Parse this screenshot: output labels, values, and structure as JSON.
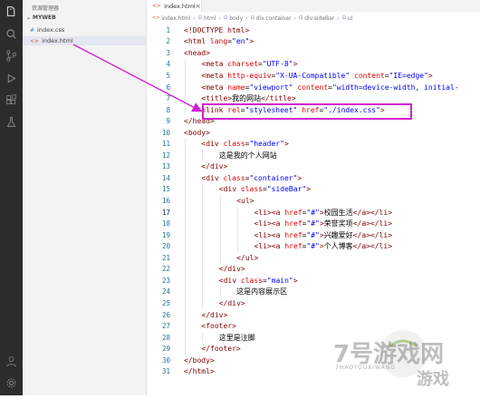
{
  "sidebar": {
    "title": "资源管理器",
    "folder": "MYWEB",
    "files": [
      {
        "name": "index.css",
        "icon": "#",
        "type": "css",
        "active": false
      },
      {
        "name": "index.html",
        "icon": "<>",
        "type": "html",
        "active": true
      }
    ]
  },
  "tab": {
    "icon": "<>",
    "label": "index.html",
    "close": "×"
  },
  "breadcrumb": [
    {
      "icon": "<>",
      "label": "index.html"
    },
    {
      "icon": "⊡",
      "label": "html"
    },
    {
      "icon": "⊡",
      "label": "body"
    },
    {
      "icon": "⊡",
      "label": "div.container"
    },
    {
      "icon": "⊡",
      "label": "div.sideBar"
    },
    {
      "icon": "⊡",
      "label": "ul"
    }
  ],
  "editor": {
    "current_line": 17,
    "lines": [
      {
        "n": 1,
        "indent": 0,
        "segs": [
          [
            "tag",
            "<!DOCTYPE html>"
          ]
        ]
      },
      {
        "n": 2,
        "indent": 0,
        "segs": [
          [
            "tag",
            "<html "
          ],
          [
            "attr",
            "lang"
          ],
          [
            "txt",
            "="
          ],
          [
            "val",
            "\"en\""
          ],
          [
            "tag",
            ">"
          ]
        ]
      },
      {
        "n": 3,
        "indent": 0,
        "segs": [
          [
            "tag",
            "<head>"
          ]
        ]
      },
      {
        "n": 4,
        "indent": 1,
        "segs": [
          [
            "tag",
            "<meta "
          ],
          [
            "attr",
            "charset"
          ],
          [
            "txt",
            "="
          ],
          [
            "val",
            "\"UTF-8\""
          ],
          [
            "tag",
            ">"
          ]
        ]
      },
      {
        "n": 5,
        "indent": 1,
        "segs": [
          [
            "tag",
            "<meta "
          ],
          [
            "attr",
            "http-equiv"
          ],
          [
            "txt",
            "="
          ],
          [
            "val",
            "\"X-UA-Compatible\""
          ],
          [
            "txt",
            " "
          ],
          [
            "attr",
            "content"
          ],
          [
            "txt",
            "="
          ],
          [
            "val",
            "\"IE=edge\""
          ],
          [
            "tag",
            ">"
          ]
        ]
      },
      {
        "n": 6,
        "indent": 1,
        "segs": [
          [
            "tag",
            "<meta "
          ],
          [
            "attr",
            "name"
          ],
          [
            "txt",
            "="
          ],
          [
            "val",
            "\"viewport\""
          ],
          [
            "txt",
            " "
          ],
          [
            "attr",
            "content"
          ],
          [
            "txt",
            "="
          ],
          [
            "val",
            "\"width=device-width, initial-"
          ]
        ]
      },
      {
        "n": 7,
        "indent": 1,
        "segs": [
          [
            "tag",
            "<title>"
          ],
          [
            "txt",
            "我的网站"
          ],
          [
            "tag",
            "</title>"
          ]
        ]
      },
      {
        "n": 8,
        "indent": 1,
        "segs": [
          [
            "tag",
            "<link "
          ],
          [
            "attr",
            "rel"
          ],
          [
            "txt",
            "="
          ],
          [
            "val",
            "\"stylesheet\""
          ],
          [
            "txt",
            " "
          ],
          [
            "attr",
            "href"
          ],
          [
            "txt",
            "="
          ],
          [
            "val",
            "\"./index.css\""
          ],
          [
            "tag",
            ">"
          ]
        ]
      },
      {
        "n": 9,
        "indent": 0,
        "segs": [
          [
            "tag",
            "</head>"
          ]
        ]
      },
      {
        "n": 10,
        "indent": 0,
        "segs": [
          [
            "tag",
            "<body>"
          ]
        ]
      },
      {
        "n": 11,
        "indent": 1,
        "segs": [
          [
            "tag",
            "<div "
          ],
          [
            "attr",
            "class"
          ],
          [
            "txt",
            "="
          ],
          [
            "val",
            "\"header\""
          ],
          [
            "tag",
            ">"
          ]
        ]
      },
      {
        "n": 12,
        "indent": 2,
        "segs": [
          [
            "txt",
            "这是我的个人网站"
          ]
        ]
      },
      {
        "n": 13,
        "indent": 1,
        "segs": [
          [
            "tag",
            "</div>"
          ]
        ]
      },
      {
        "n": 14,
        "indent": 1,
        "segs": [
          [
            "tag",
            "<div "
          ],
          [
            "attr",
            "class"
          ],
          [
            "txt",
            "="
          ],
          [
            "val",
            "\"container\""
          ],
          [
            "tag",
            ">"
          ]
        ]
      },
      {
        "n": 15,
        "indent": 2,
        "segs": [
          [
            "tag",
            "<div "
          ],
          [
            "attr",
            "class"
          ],
          [
            "txt",
            "="
          ],
          [
            "val",
            "\"sideBar\""
          ],
          [
            "tag",
            ">"
          ]
        ]
      },
      {
        "n": 16,
        "indent": 3,
        "segs": [
          [
            "tag",
            "<ul>"
          ]
        ]
      },
      {
        "n": 17,
        "indent": 4,
        "segs": [
          [
            "tag",
            "<li><a "
          ],
          [
            "attr",
            "href"
          ],
          [
            "txt",
            "="
          ],
          [
            "val",
            "\"#\""
          ],
          [
            "tag",
            ">"
          ],
          [
            "txt",
            "校园生活"
          ],
          [
            "tag",
            "</a></li>"
          ]
        ]
      },
      {
        "n": 18,
        "indent": 4,
        "segs": [
          [
            "tag",
            "<li><a "
          ],
          [
            "attr",
            "href"
          ],
          [
            "txt",
            "="
          ],
          [
            "val",
            "\"#\""
          ],
          [
            "tag",
            ">"
          ],
          [
            "txt",
            "荣誉奖项"
          ],
          [
            "tag",
            "</a></li>"
          ]
        ]
      },
      {
        "n": 19,
        "indent": 4,
        "segs": [
          [
            "tag",
            "<li><a "
          ],
          [
            "attr",
            "href"
          ],
          [
            "txt",
            "="
          ],
          [
            "val",
            "\"#\""
          ],
          [
            "tag",
            ">"
          ],
          [
            "txt",
            "兴趣爱好"
          ],
          [
            "tag",
            "</a></li>"
          ]
        ]
      },
      {
        "n": 20,
        "indent": 4,
        "segs": [
          [
            "tag",
            "<li><a "
          ],
          [
            "attr",
            "href"
          ],
          [
            "txt",
            "="
          ],
          [
            "val",
            "\"#\""
          ],
          [
            "tag",
            ">"
          ],
          [
            "txt",
            "个人博客"
          ],
          [
            "tag",
            "</a></li>"
          ]
        ]
      },
      {
        "n": 21,
        "indent": 3,
        "segs": [
          [
            "tag",
            "</ul>"
          ]
        ]
      },
      {
        "n": 22,
        "indent": 2,
        "segs": [
          [
            "tag",
            "</div>"
          ]
        ]
      },
      {
        "n": 23,
        "indent": 2,
        "segs": [
          [
            "tag",
            "<div "
          ],
          [
            "attr",
            "class"
          ],
          [
            "txt",
            "="
          ],
          [
            "val",
            "\"main\""
          ],
          [
            "tag",
            ">"
          ]
        ]
      },
      {
        "n": 24,
        "indent": 3,
        "segs": [
          [
            "txt",
            "这是内容展示区"
          ]
        ]
      },
      {
        "n": 25,
        "indent": 2,
        "segs": [
          [
            "tag",
            "</div>"
          ]
        ]
      },
      {
        "n": 26,
        "indent": 1,
        "segs": [
          [
            "tag",
            "</div>"
          ]
        ]
      },
      {
        "n": 27,
        "indent": 1,
        "segs": [
          [
            "tag",
            "<footer>"
          ]
        ]
      },
      {
        "n": 28,
        "indent": 2,
        "segs": [
          [
            "txt",
            "这里是注脚"
          ]
        ]
      },
      {
        "n": 29,
        "indent": 1,
        "segs": [
          [
            "tag",
            "</footer>"
          ]
        ]
      },
      {
        "n": 30,
        "indent": 0,
        "segs": [
          [
            "tag",
            "</body>"
          ]
        ]
      },
      {
        "n": 31,
        "indent": 0,
        "segs": [
          [
            "tag",
            "</html>"
          ]
        ]
      }
    ]
  },
  "watermark": {
    "big_text": "7号游戏网",
    "mid_text": "游戏",
    "sub_text": "7HAOYOUXIWANG"
  },
  "colors": {
    "highlight": "#d11fd1",
    "tag": "#800000",
    "attr": "#e50000",
    "value": "#0000ff"
  }
}
